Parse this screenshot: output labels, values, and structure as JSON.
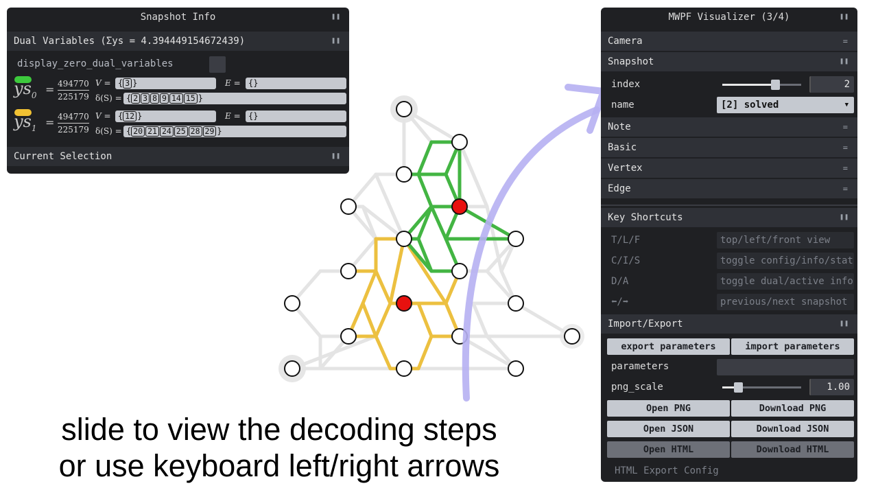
{
  "snapshot_info": {
    "title": "Snapshot Info",
    "dual_header": "Dual Variables (Σys = 4.394449154672439)",
    "display_zero_label": "display_zero_dual_variables",
    "duals": [
      {
        "color": "#3dc93d",
        "symbol": "ys",
        "sub": "0",
        "num": "494770",
        "den": "225179",
        "V": "3",
        "E": "",
        "S": [
          "2",
          "3",
          "8",
          "9",
          "14",
          "15"
        ]
      },
      {
        "color": "#f2c233",
        "symbol": "ys",
        "sub": "1",
        "num": "494770",
        "den": "225179",
        "V": "12",
        "E": "",
        "S": [
          "20",
          "21",
          "24",
          "25",
          "28",
          "29"
        ]
      }
    ],
    "v_label": "V",
    "e_label": "E",
    "delta_label": "δ(S)",
    "current_selection": "Current Selection"
  },
  "visualizer": {
    "title": "MWPF Visualizer (3/4)",
    "camera": "Camera",
    "snapshot": "Snapshot",
    "index_label": "index",
    "index_value": "2",
    "index_fraction": 0.67,
    "name_label": "name",
    "name_value": "[2] solved",
    "note": "Note",
    "basic": "Basic",
    "vertex": "Vertex",
    "edge": "Edge",
    "key_shortcuts": "Key Shortcuts",
    "shortcuts": [
      {
        "key": "T/L/F",
        "desc": "top/left/front view"
      },
      {
        "key": "C/I/S",
        "desc": "toggle config/info/stat"
      },
      {
        "key": "D/A",
        "desc": "toggle dual/active info"
      },
      {
        "key": "⬅/➡",
        "desc": "previous/next snapshot"
      }
    ],
    "import_export": "Import/Export",
    "export_params": "export parameters",
    "import_params": "import parameters",
    "parameters_label": "parameters",
    "parameters_value": "",
    "png_scale_label": "png_scale",
    "png_scale_value": "1.00",
    "png_scale_fraction": 0.2,
    "open_png": "Open PNG",
    "download_png": "Download PNG",
    "open_json": "Open JSON",
    "download_json": "Download JSON",
    "open_html": "Open HTML",
    "download_html": "Download HTML",
    "html_export_config": "HTML Export Config"
  },
  "caption": {
    "line1": "slide to view the decoding steps",
    "line2": "or use keyboard left/right arrows"
  },
  "colors": {
    "green": "#43b543",
    "yellow": "#ecc040",
    "defect": "#e8110f",
    "arrow": "#b6b0f2"
  }
}
